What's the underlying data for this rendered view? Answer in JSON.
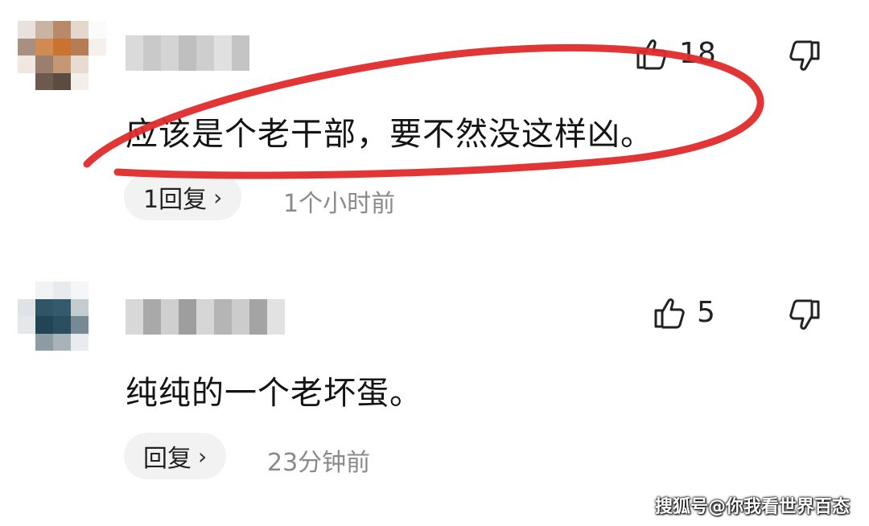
{
  "comments": [
    {
      "likes": "18",
      "text": "应该是个老干部，要不然没这样凶。",
      "reply_label": "1回复",
      "reply_chevron": "›",
      "time": "1个小时前"
    },
    {
      "likes": "5",
      "text": "纯纯的一个老坏蛋。",
      "reply_label": "回复",
      "reply_chevron": "›",
      "time": "23分钟前"
    }
  ],
  "watermark": "搜狐号@你我看世界百态",
  "colors": {
    "annotation_red": "#e02b2b",
    "time_gray": "#8a8a8a",
    "reply_bg": "#f2f2f2"
  },
  "icons": {
    "like": "thumbs-up-icon",
    "dislike": "thumbs-down-icon"
  }
}
